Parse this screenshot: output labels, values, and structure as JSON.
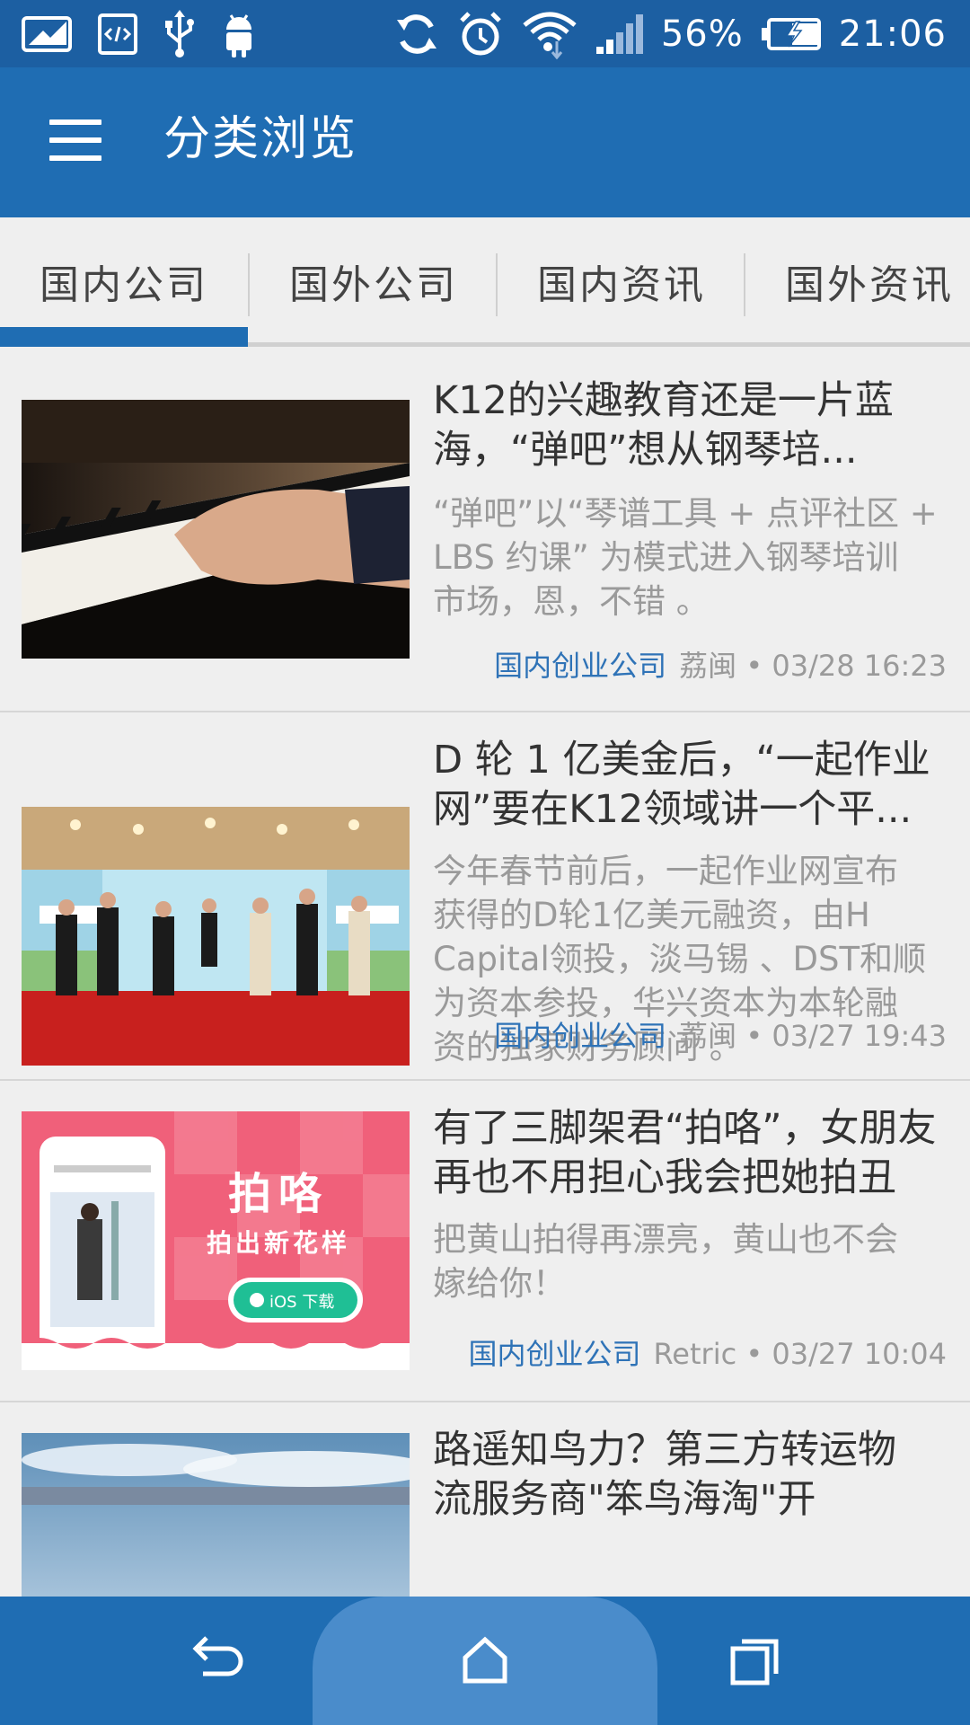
{
  "status_bar": {
    "battery": "56%",
    "time": "21:06",
    "icons": [
      "image-icon",
      "code-icon",
      "usb-icon",
      "android-icon",
      "sync-icon",
      "alarm-icon",
      "wifi-icon",
      "signal-icon",
      "battery-charging-icon"
    ]
  },
  "app_bar": {
    "title": "分类浏览",
    "menu_icon": "menu-icon"
  },
  "tabs": [
    {
      "label": "国内公司",
      "selected": true
    },
    {
      "label": "国外公司",
      "selected": false
    },
    {
      "label": "国内资讯",
      "selected": false
    },
    {
      "label": "国外资讯",
      "selected": false
    }
  ],
  "colors": {
    "status_bar": "#1c5fa2",
    "app_bar": "#1f6db3",
    "accent": "#1f6db3",
    "category": "#2f73b7",
    "background": "#efefef"
  },
  "articles": [
    {
      "title_line1": "K12的兴趣教育还是一片蓝",
      "title_line2": "海，“弹吧”想从钢琴培...",
      "summary_line1": "“弹吧”以“琴谱工具 + 点评社区 +",
      "summary_line2": "LBS 约课” 为模式进入钢琴培训",
      "summary_line3": "市场，恩，不错 。",
      "category": "国内创业公司",
      "author_time": "荔闽 • 03/28 16:23",
      "image": "piano-photo"
    },
    {
      "title_line1": "D 轮 1 亿美金后，“一起作业",
      "title_line2": "网”要在K12领域讲一个平...",
      "summary_line1": "今年春节前后，一起作业网宣布",
      "summary_line2": "获得的D轮1亿美元融资，由H",
      "summary_line3": "Capital领投，淡马锡 、DST和顺",
      "summary_line4": "为资本参投，华兴资本为本轮融",
      "summary_line5": "资的独家财务顾问 。",
      "category": "国内创业公司",
      "author_time": "荔闽 • 03/27 19:43",
      "image": "stage-event-photo"
    },
    {
      "title_line1": "有了三脚架君“拍咯”，女朋友",
      "title_line2": "再也不用担心我会把她拍丑",
      "summary_line1": "把黄山拍得再漂亮，黄山也不会",
      "summary_line2": "嫁给你！",
      "category": "国内创业公司",
      "author_time": "Retric • 03/27 10:04",
      "image": "app-promo-image",
      "promo_title": "拍咯",
      "promo_subtitle": "拍出新花样",
      "promo_button": "iOS 下载"
    },
    {
      "title_line1": "路遥知鸟力？第三方转运物",
      "title_line2": "流服务商\"笨鸟海淘\"开",
      "image": "sky-photo"
    }
  ],
  "nav_bar": {
    "icons": [
      "back-icon",
      "home-icon",
      "recents-icon"
    ]
  }
}
